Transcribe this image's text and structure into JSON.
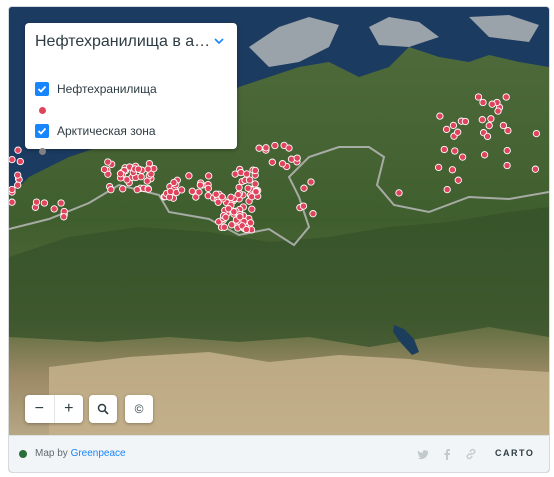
{
  "legend": {
    "title": "Нефтехранилища в арк…",
    "layers": [
      {
        "label": "Нефтехранилища",
        "checked": true,
        "color": "#e0445c"
      },
      {
        "label": "Арктическая зона",
        "checked": true,
        "color": "#808080"
      }
    ]
  },
  "controls": {
    "zoom_out": "−",
    "zoom_in": "+",
    "search_icon": "search-icon",
    "attribution_label": "©"
  },
  "footer": {
    "credit_prefix": "Map by",
    "credit_link": "Greenpeace",
    "share_icons": [
      "twitter-icon",
      "facebook-icon",
      "link-icon"
    ],
    "carto_logo": "CARTO"
  },
  "colors": {
    "accent": "#1785fb",
    "marker": "#e0445c",
    "arctic_boundary": "#b9b9b9"
  }
}
